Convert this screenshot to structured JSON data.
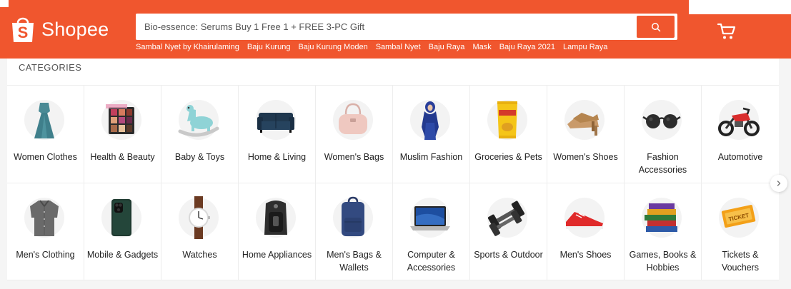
{
  "header": {
    "logo_text": "Shopee",
    "search_placeholder": "Bio-essence: Serums Buy 1 Free 1 + FREE 3-PC Gift",
    "trending": [
      "Sambal Nyet by Khairulaming",
      "Baju Kurung",
      "Baju Kurung Moden",
      "Sambal Nyet",
      "Baju Raya",
      "Mask",
      "Baju Raya 2021",
      "Lampu Raya"
    ]
  },
  "categories": {
    "title": "CATEGORIES",
    "items": [
      {
        "label": "Women Clothes",
        "icon": "dress-icon"
      },
      {
        "label": "Health & Beauty",
        "icon": "makeup-palette-icon"
      },
      {
        "label": "Baby & Toys",
        "icon": "rocking-horse-icon"
      },
      {
        "label": "Home & Living",
        "icon": "sofa-icon"
      },
      {
        "label": "Women's Bags",
        "icon": "handbag-icon"
      },
      {
        "label": "Muslim Fashion",
        "icon": "hijab-icon"
      },
      {
        "label": "Groceries & Pets",
        "icon": "chips-icon"
      },
      {
        "label": "Women's Shoes",
        "icon": "heel-shoe-icon"
      },
      {
        "label": "Fashion Accessories",
        "icon": "sunglasses-icon"
      },
      {
        "label": "Automotive",
        "icon": "motorcycle-icon"
      },
      {
        "label": "Men's Clothing",
        "icon": "shirt-icon"
      },
      {
        "label": "Mobile & Gadgets",
        "icon": "phone-icon"
      },
      {
        "label": "Watches",
        "icon": "watch-icon"
      },
      {
        "label": "Home Appliances",
        "icon": "air-fryer-icon"
      },
      {
        "label": "Men's Bags & Wallets",
        "icon": "backpack-icon"
      },
      {
        "label": "Computer & Accessories",
        "icon": "laptop-icon"
      },
      {
        "label": "Sports & Outdoor",
        "icon": "dumbbell-icon"
      },
      {
        "label": "Men's Shoes",
        "icon": "sneaker-icon"
      },
      {
        "label": "Games, Books & Hobbies",
        "icon": "books-icon"
      },
      {
        "label": "Tickets & Vouchers",
        "icon": "ticket-icon"
      }
    ]
  },
  "colors": {
    "brand": "#f0562e",
    "text": "#222222",
    "muted": "#555555"
  }
}
